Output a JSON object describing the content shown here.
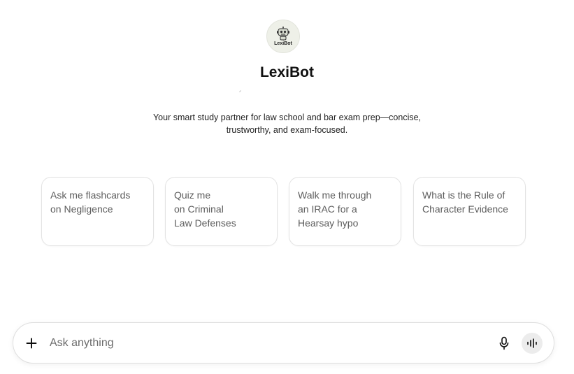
{
  "bot": {
    "avatar_text": "LexiBot",
    "name": "LexiBot",
    "tagline_line1": "Your smart study partner for law school and bar exam prep—concise,",
    "tagline_line2": "trustworthy, and exam-focused."
  },
  "suggestions": [
    {
      "lines": [
        "Ask me flashcards",
        "on Negligence"
      ]
    },
    {
      "lines": [
        "Quiz me",
        "on Criminal",
        "Law Defenses"
      ]
    },
    {
      "lines": [
        "Walk me through",
        "an IRAC for a",
        "Hearsay hypo"
      ]
    },
    {
      "lines": [
        "What is the Rule of",
        "Character Evidence"
      ]
    }
  ],
  "composer": {
    "placeholder": "Ask anything",
    "value": "",
    "icons": {
      "attach": "plus-icon",
      "dictate": "microphone-icon",
      "voice": "voice-mode-icon"
    }
  },
  "colors": {
    "avatar_bg": "#eef0e8",
    "card_text": "#5d5d5d",
    "voice_button_bg": "#ececec"
  }
}
